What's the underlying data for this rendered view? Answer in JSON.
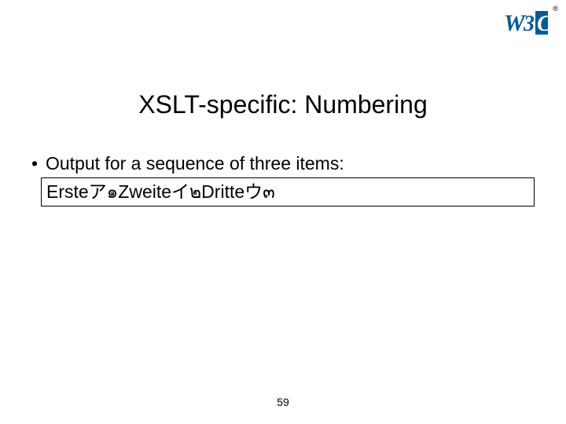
{
  "logo": {
    "name": "w3c-logo",
    "text_w": "W",
    "text_3": "3",
    "text_c": "C",
    "trademark": "®",
    "blue": "#005a9c"
  },
  "title": "XSLT-specific: Numbering",
  "bullet": {
    "marker": "•",
    "text": "Output for a sequence of three items:"
  },
  "output_box": "Ersteア๑Zweiteイ๒Dritteウ๓",
  "page_number": "59"
}
